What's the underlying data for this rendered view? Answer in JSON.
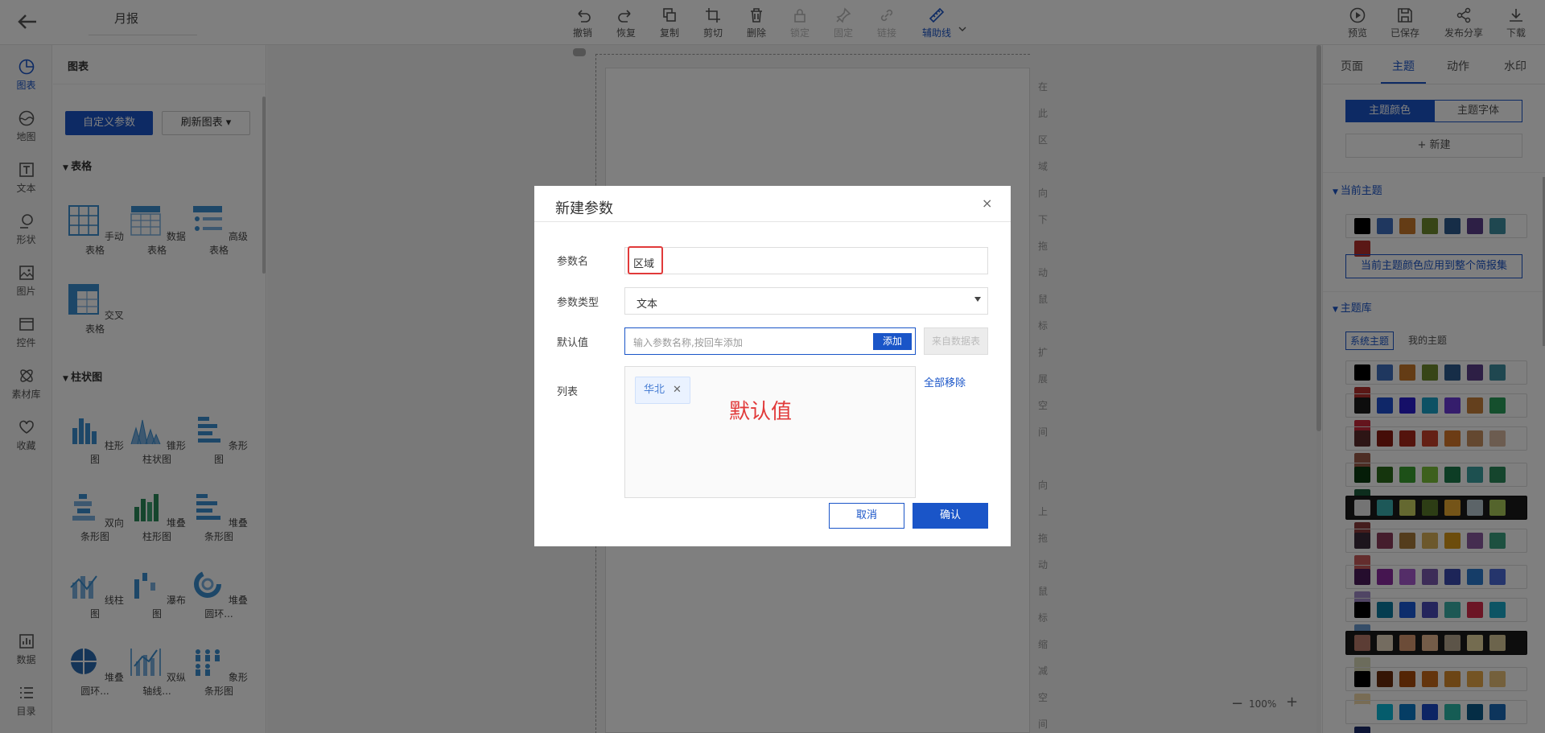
{
  "header": {
    "title": "月报",
    "tools": [
      {
        "label": "撤销",
        "icon": "undo-icon"
      },
      {
        "label": "恢复",
        "icon": "redo-icon"
      },
      {
        "label": "复制",
        "icon": "copy-icon"
      },
      {
        "label": "剪切",
        "icon": "crop-icon"
      },
      {
        "label": "删除",
        "icon": "trash-icon"
      },
      {
        "label": "锁定",
        "icon": "lock-icon"
      },
      {
        "label": "固定",
        "icon": "pin-icon"
      },
      {
        "label": "链接",
        "icon": "link-icon"
      },
      {
        "label": "辅助线",
        "icon": "ruler-icon"
      }
    ],
    "actions": [
      {
        "label": "预览",
        "icon": "play-icon"
      },
      {
        "label": "已保存",
        "icon": "save-icon"
      },
      {
        "label": "发布分享",
        "icon": "share-icon"
      },
      {
        "label": "下载",
        "icon": "download-icon"
      }
    ]
  },
  "rail": {
    "top": [
      "图表",
      "地图",
      "文本",
      "形状",
      "图片",
      "控件",
      "素材库",
      "收藏"
    ],
    "bottom": [
      "数据",
      "目录"
    ]
  },
  "panel": {
    "title": "图表",
    "custom_params_button": "自定义参数",
    "refresh_button": "刷新图表 ▾",
    "sections": {
      "table": "表格",
      "bar": "柱状图"
    },
    "table_items": [
      "手动表格",
      "数据表格",
      "高级表格",
      "交叉表格"
    ],
    "bar_items": [
      "柱形图",
      "锥形柱状图",
      "条形图",
      "双向条形图",
      "堆叠柱形图",
      "堆叠条形图",
      "线柱图",
      "瀑布图",
      "堆叠圆环...",
      "堆叠圆环...",
      "双纵轴线...",
      "象形条形图"
    ]
  },
  "canvas": {
    "vertical_hint_1": [
      "在",
      "此",
      "区",
      "域",
      "向",
      "下",
      "拖",
      "动",
      "鼠",
      "标",
      "扩",
      "展",
      "空",
      "间"
    ],
    "vertical_hint_2": [
      "向",
      "上",
      "拖",
      "动",
      "鼠",
      "标",
      "缩",
      "减",
      "空",
      "间"
    ],
    "zoom": "100%"
  },
  "right_panel": {
    "tabs": [
      "页面",
      "主题",
      "动作",
      "水印"
    ],
    "active_tab": "主题",
    "segments": [
      "主题颜色",
      "主题字体"
    ],
    "new_button": "+ 新建",
    "current_theme_label": "当前主题",
    "apply_button": "当前主题颜色应用到整个简报集",
    "library_label": "主题库",
    "library_tabs": [
      "系统主题",
      "我的主题"
    ],
    "current_palette": [
      "#000000",
      "#3e6fbf",
      "#c8792a",
      "#6f8a2e",
      "#2c5b8f",
      "#5a3e8a",
      "#3f8fa0",
      "#b5302d"
    ],
    "palettes": [
      [
        "#000000",
        "#3e6fbf",
        "#c8792a",
        "#6f8a2e",
        "#2c5b8f",
        "#5a3e8a",
        "#3f8fa0",
        "#b5302d"
      ],
      [
        "#1a1a1a",
        "#1e4fd1",
        "#2a1fd0",
        "#1aa3c8",
        "#6a3ad8",
        "#c8803a",
        "#2a9e5a",
        "#c8283a"
      ],
      [
        "#5a2a2a",
        "#8a1a10",
        "#a8281a",
        "#c8402a",
        "#d8782a",
        "#c89060",
        "#d8b8a0",
        "#9a5a48"
      ],
      [
        "#0a3a10",
        "#2a6a1a",
        "#3aa030",
        "#7ac03a",
        "#1a7a4a",
        "#3aa0a0",
        "#2a8a5a",
        "#1a5a3a"
      ],
      [
        "#e8e8e8",
        "#3ab0b0",
        "#c8d060",
        "#5a7a2a",
        "#e8a830",
        "#b8c8d0",
        "#a8c858",
        "#8a3a3a"
      ],
      [
        "#3a2a3a",
        "#8a3a5a",
        "#a87a3a",
        "#d8b058",
        "#d89818",
        "#8a5aa0",
        "#3aa080",
        "#c85a5a"
      ],
      [
        "#4a1a5a",
        "#8a2aa0",
        "#a85ad0",
        "#7a5ab0",
        "#3a4ab0",
        "#2a7ad0",
        "#4a6ad8",
        "#a08ac8"
      ],
      [
        "#000000",
        "#0a7aa0",
        "#1a5ad8",
        "#4a4ab8",
        "#3ab0a8",
        "#d82a4a",
        "#1aa8c8",
        "#6a9ad0"
      ],
      [
        "#b87a6a",
        "#e8d8c0",
        "#d89870",
        "#e8b890",
        "#b8a890",
        "#e8d8a0",
        "#d8c898",
        "#d8d8b8"
      ],
      [
        "#000000",
        "#6a2a0a",
        "#a84a0a",
        "#c86a1a",
        "#d88a2a",
        "#e8a848",
        "#e8c078",
        "#f0d8a8"
      ],
      [
        "#ffffff",
        "#0ab8d8",
        "#0a7ac8",
        "#1a4ac8",
        "#2ab8a8",
        "#0a5a8a",
        "#1a6ab8",
        "#1a2a6a"
      ]
    ]
  },
  "dialog": {
    "title": "新建参数",
    "close": "×",
    "name_label": "参数名",
    "name_value": "区域",
    "type_label": "参数类型",
    "type_value": "文本",
    "default_label": "默认值",
    "default_placeholder": "输入参数名称,按回车添加",
    "add_button": "添加",
    "from_table_button": "来自数据表",
    "list_label": "列表",
    "remove_all": "全部移除",
    "tags": [
      "华北"
    ],
    "annotation": "默认值",
    "cancel": "取消",
    "confirm": "确认"
  }
}
